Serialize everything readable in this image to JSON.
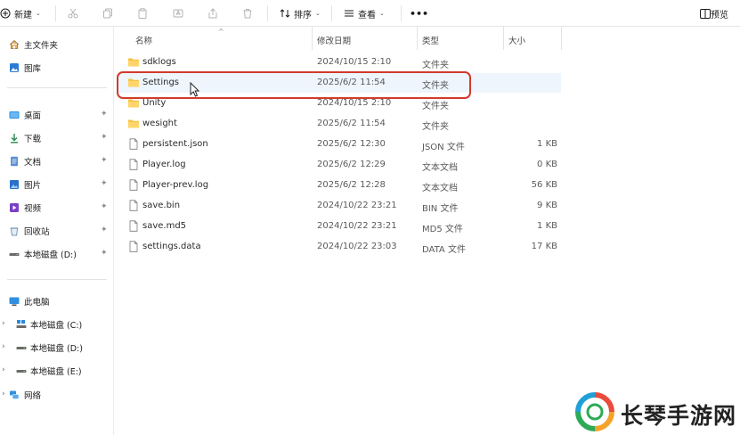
{
  "toolbar": {
    "new_label": "新建",
    "sort_label": "排序",
    "view_label": "查看",
    "more_label": "•••",
    "preview_label": "预览"
  },
  "sidebar": {
    "top": [
      {
        "label": "主文件夹",
        "icon": "home-icon"
      },
      {
        "label": "图库",
        "icon": "gallery-icon"
      }
    ],
    "pinned": [
      {
        "label": "桌面",
        "icon": "desktop-icon"
      },
      {
        "label": "下载",
        "icon": "download-icon"
      },
      {
        "label": "文档",
        "icon": "document-icon"
      },
      {
        "label": "图片",
        "icon": "picture-icon"
      },
      {
        "label": "视频",
        "icon": "video-icon"
      },
      {
        "label": "回收站",
        "icon": "recycle-bin-icon"
      },
      {
        "label": "本地磁盘 (D:)",
        "icon": "drive-icon"
      }
    ],
    "this_pc": "此电脑",
    "drives": [
      {
        "label": "本地磁盘 (C:)",
        "icon": "system-drive-icon"
      },
      {
        "label": "本地磁盘 (D:)",
        "icon": "drive-icon"
      },
      {
        "label": "本地磁盘 (E:)",
        "icon": "drive-icon"
      }
    ],
    "network": "网络"
  },
  "columns": {
    "name": "名称",
    "date": "修改日期",
    "type": "类型",
    "size": "大小"
  },
  "files": [
    {
      "name": "sdklogs",
      "date": "2024/10/15 2:10",
      "type": "文件夹",
      "size": "",
      "kind": "folder"
    },
    {
      "name": "Settings",
      "date": "2025/6/2 11:54",
      "type": "文件夹",
      "size": "",
      "kind": "folder"
    },
    {
      "name": "Unity",
      "date": "2024/10/15 2:10",
      "type": "文件夹",
      "size": "",
      "kind": "folder"
    },
    {
      "name": "wesight",
      "date": "2025/6/2 11:54",
      "type": "文件夹",
      "size": "",
      "kind": "folder"
    },
    {
      "name": "persistent.json",
      "date": "2025/6/2 12:30",
      "type": "JSON 文件",
      "size": "1 KB",
      "kind": "file"
    },
    {
      "name": "Player.log",
      "date": "2025/6/2 12:29",
      "type": "文本文档",
      "size": "0 KB",
      "kind": "file"
    },
    {
      "name": "Player-prev.log",
      "date": "2025/6/2 12:28",
      "type": "文本文档",
      "size": "56 KB",
      "kind": "file"
    },
    {
      "name": "save.bin",
      "date": "2024/10/22 23:21",
      "type": "BIN 文件",
      "size": "9 KB",
      "kind": "file"
    },
    {
      "name": "save.md5",
      "date": "2024/10/22 23:21",
      "type": "MD5 文件",
      "size": "1 KB",
      "kind": "file"
    },
    {
      "name": "settings.data",
      "date": "2024/10/22 23:03",
      "type": "DATA 文件",
      "size": "17 KB",
      "kind": "file"
    }
  ],
  "watermark": {
    "text": "长琴手游网"
  },
  "colors": {
    "folder": "#f5c344",
    "highlight": "#d23a2a",
    "selection": "#eef5fd"
  }
}
